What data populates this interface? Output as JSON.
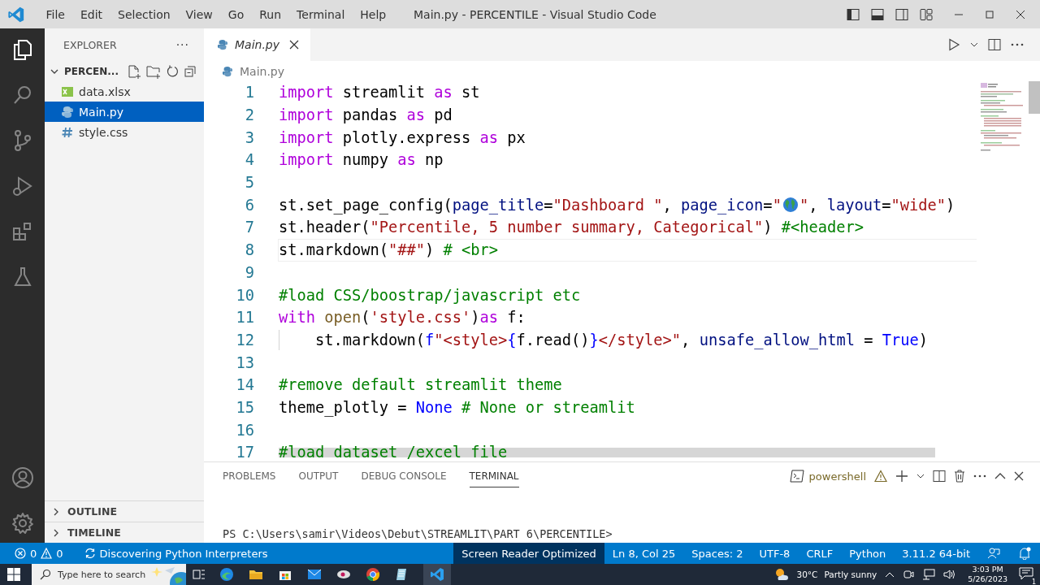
{
  "title_bar": {
    "menu": [
      "File",
      "Edit",
      "Selection",
      "View",
      "Go",
      "Run",
      "Terminal",
      "Help"
    ],
    "title": "Main.py - PERCENTILE - Visual Studio Code"
  },
  "sidebar": {
    "title": "EXPLORER",
    "more": "···",
    "folder": {
      "name": "PERCEN...",
      "expanded": true
    },
    "files": [
      {
        "name": "data.xlsx",
        "kind": "excel",
        "selected": false
      },
      {
        "name": "Main.py",
        "kind": "python",
        "selected": true
      },
      {
        "name": "style.css",
        "kind": "css",
        "selected": false
      }
    ],
    "sections": [
      {
        "label": "OUTLINE",
        "expanded": false
      },
      {
        "label": "TIMELINE",
        "expanded": false
      }
    ]
  },
  "editor": {
    "tabs": [
      {
        "label": "Main.py",
        "selected": true
      }
    ],
    "breadcrumb": "Main.py",
    "lines": [
      {
        "number": "1",
        "current": false,
        "tokens": [
          {
            "kind": "kw",
            "t": "import"
          },
          {
            "kind": "plain",
            "t": " streamlit "
          },
          {
            "kind": "kw",
            "t": "as"
          },
          {
            "kind": "plain",
            "t": " st"
          }
        ]
      },
      {
        "number": "2",
        "current": false,
        "tokens": [
          {
            "kind": "kw",
            "t": "import"
          },
          {
            "kind": "plain",
            "t": " pandas "
          },
          {
            "kind": "kw",
            "t": "as"
          },
          {
            "kind": "plain",
            "t": " pd"
          }
        ]
      },
      {
        "number": "3",
        "current": false,
        "tokens": [
          {
            "kind": "kw",
            "t": "import"
          },
          {
            "kind": "plain",
            "t": " plotly.express "
          },
          {
            "kind": "kw",
            "t": "as"
          },
          {
            "kind": "plain",
            "t": " px"
          }
        ]
      },
      {
        "number": "4",
        "current": false,
        "tokens": [
          {
            "kind": "kw",
            "t": "import"
          },
          {
            "kind": "plain",
            "t": " numpy "
          },
          {
            "kind": "kw",
            "t": "as"
          },
          {
            "kind": "plain",
            "t": " np"
          }
        ]
      },
      {
        "number": "5",
        "current": false
      },
      {
        "number": "6",
        "current": false,
        "tokens": [
          {
            "kind": "plain",
            "t": "st.set_page_config("
          },
          {
            "kind": "param",
            "t": "page_title"
          },
          {
            "kind": "plain",
            "t": "="
          },
          {
            "kind": "str",
            "t": "\"Dashboard \""
          },
          {
            "kind": "plain",
            "t": ", "
          },
          {
            "kind": "param",
            "t": "page_icon"
          },
          {
            "kind": "plain",
            "t": "="
          },
          {
            "kind": "str",
            "t": "\""
          },
          {
            "kind": "globe"
          },
          {
            "kind": "str",
            "t": "\""
          },
          {
            "kind": "plain",
            "t": ", "
          },
          {
            "kind": "param",
            "t": "layout"
          },
          {
            "kind": "plain",
            "t": "="
          },
          {
            "kind": "str",
            "t": "\"wide\""
          },
          {
            "kind": "plain",
            "t": ")"
          }
        ]
      },
      {
        "number": "7",
        "current": false,
        "tokens": [
          {
            "kind": "plain",
            "t": "st.header("
          },
          {
            "kind": "str",
            "t": "\"Percentile, 5 number summary, Categorical\""
          },
          {
            "kind": "plain",
            "t": ") "
          },
          {
            "kind": "com",
            "t": "#<header>"
          }
        ]
      },
      {
        "number": "8",
        "current": true,
        "tokens": [
          {
            "kind": "plain",
            "t": "st.markdown("
          },
          {
            "kind": "str",
            "t": "\"##\""
          },
          {
            "kind": "plain",
            "t": ") "
          },
          {
            "kind": "com",
            "t": "# <br>"
          }
        ]
      },
      {
        "number": "9",
        "current": false
      },
      {
        "number": "10",
        "current": false,
        "tokens": [
          {
            "kind": "com",
            "t": "#load CSS/boostrap/javascript etc"
          }
        ]
      },
      {
        "number": "11",
        "current": false,
        "tokens": [
          {
            "kind": "kw",
            "t": "with "
          },
          {
            "kind": "fn",
            "t": "open"
          },
          {
            "kind": "plain",
            "t": "("
          },
          {
            "kind": "str",
            "t": "'style.css'"
          },
          {
            "kind": "plain",
            "t": ")"
          },
          {
            "kind": "kw",
            "t": "as"
          },
          {
            "kind": "plain",
            "t": " f:"
          }
        ]
      },
      {
        "number": "12",
        "current": false,
        "indent_guide": true,
        "tokens": [
          {
            "kind": "plain",
            "t": "    st.markdown("
          },
          {
            "kind": "const",
            "t": "f"
          },
          {
            "kind": "str",
            "t": "\"<style>"
          },
          {
            "kind": "const",
            "t": "{"
          },
          {
            "kind": "plain",
            "t": "f.read()"
          },
          {
            "kind": "const",
            "t": "}"
          },
          {
            "kind": "str",
            "t": "</style>\""
          },
          {
            "kind": "plain",
            "t": ", "
          },
          {
            "kind": "param",
            "t": "unsafe_allow_html"
          },
          {
            "kind": "plain",
            "t": " = "
          },
          {
            "kind": "const",
            "t": "True"
          },
          {
            "kind": "plain",
            "t": ")"
          }
        ]
      },
      {
        "number": "13",
        "current": false
      },
      {
        "number": "14",
        "current": false,
        "tokens": [
          {
            "kind": "com",
            "t": "#remove default streamlit theme"
          }
        ]
      },
      {
        "number": "15",
        "current": false,
        "tokens": [
          {
            "kind": "plain",
            "t": "theme_plotly = "
          },
          {
            "kind": "const",
            "t": "None"
          },
          {
            "kind": "com",
            "t": " # None or streamlit"
          }
        ]
      },
      {
        "number": "16",
        "current": false
      },
      {
        "number": "17",
        "current": false,
        "tokens": [
          {
            "kind": "com",
            "t": "#load dataset /excel file"
          }
        ]
      }
    ]
  },
  "panel": {
    "tabs": [
      {
        "label": "PROBLEMS",
        "selected": false
      },
      {
        "label": "OUTPUT",
        "selected": false
      },
      {
        "label": "DEBUG CONSOLE",
        "selected": false
      },
      {
        "label": "TERMINAL",
        "selected": true
      }
    ],
    "shell": "powershell",
    "prompt": "PS C:\\Users\\samir\\Videos\\Debut\\STREAMLIT\\PART 6\\PERCENTILE>"
  },
  "status_bar": {
    "errors": "0",
    "warnings": "0",
    "task": "Discovering Python Interpreters",
    "right": [
      {
        "text": "Screen Reader Optimized",
        "highlighted": true
      },
      {
        "text": "Ln 8, Col 25",
        "highlighted": false
      },
      {
        "text": "Spaces: 2",
        "highlighted": false
      },
      {
        "text": "UTF-8",
        "highlighted": false
      },
      {
        "text": "CRLF",
        "highlighted": false
      },
      {
        "text": "Python",
        "highlighted": false
      },
      {
        "text": "3.11.2 64-bit",
        "highlighted": false
      }
    ]
  },
  "taskbar": {
    "search_placeholder": "Type here to search",
    "temperature": "30°C",
    "weather": "Partly sunny",
    "time": "3:03 PM",
    "date": "5/26/2023",
    "notifications": "1"
  }
}
